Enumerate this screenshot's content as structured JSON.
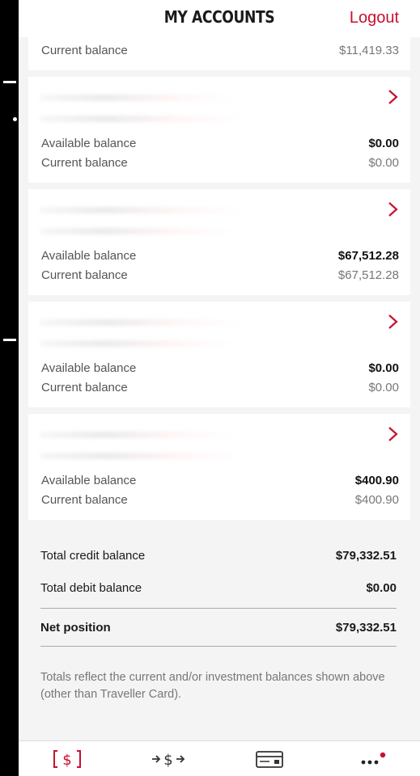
{
  "header": {
    "title": "MY ACCOUNTS",
    "logout_label": "Logout"
  },
  "top_partial": {
    "current_label": "Current balance",
    "current_value": "$11,419.33"
  },
  "accounts": [
    {
      "available_label": "Available balance",
      "available_value": "$0.00",
      "current_label": "Current balance",
      "current_value": "$0.00"
    },
    {
      "available_label": "Available balance",
      "available_value": "$67,512.28",
      "current_label": "Current balance",
      "current_value": "$67,512.28"
    },
    {
      "available_label": "Available balance",
      "available_value": "$0.00",
      "current_label": "Current balance",
      "current_value": "$0.00"
    },
    {
      "available_label": "Available balance",
      "available_value": "$400.90",
      "current_label": "Current balance",
      "current_value": "$400.90"
    }
  ],
  "totals": {
    "credit_label": "Total credit balance",
    "credit_value": "$79,332.51",
    "debit_label": "Total debit balance",
    "debit_value": "$0.00",
    "net_label": "Net position",
    "net_value": "$79,332.51"
  },
  "note": "Totals reflect the current and/or investment balances shown above (other than Traveller Card).",
  "tabbar": {
    "accounts_icon": "dollar-bracket-icon",
    "transfer_icon": "transfer-arrows-icon",
    "cards_icon": "card-icon",
    "more_icon": "more-dots-icon"
  },
  "colors": {
    "brand": "#c8102e",
    "background": "#f4f4f4",
    "card": "#ffffff"
  }
}
